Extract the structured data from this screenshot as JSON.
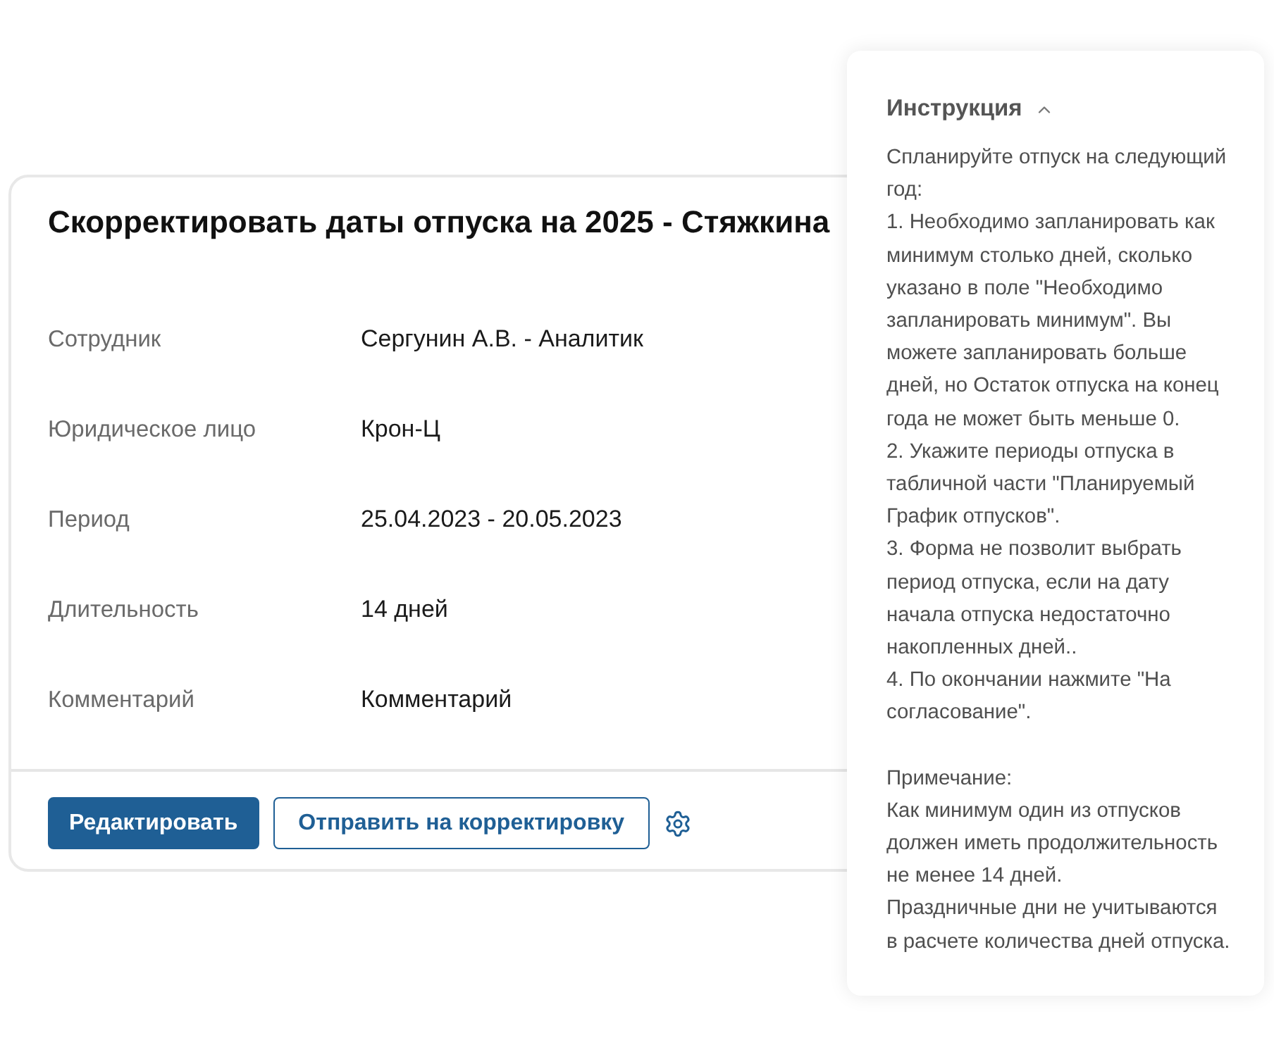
{
  "card": {
    "title": "Скорректировать даты отпуска на 2025 - Стяжкина",
    "fields": [
      {
        "label": "Сотрудник",
        "value": "Сергунин А.В. - Аналитик"
      },
      {
        "label": "Юридическое лицо",
        "value": "Крон-Ц"
      },
      {
        "label": "Период",
        "value": "25.04.2023 - 20.05.2023"
      },
      {
        "label": "Длительность",
        "value": "14 дней"
      },
      {
        "label": "Комментарий",
        "value": "Комментарий"
      }
    ],
    "buttons": [
      {
        "kind": "primary",
        "label": "Редактировать"
      },
      {
        "kind": "secondary",
        "label": "Отправить на корректировку"
      }
    ]
  },
  "instruction": {
    "title": "Инструкция",
    "expanded": true,
    "sections": [
      {
        "paragraphs": [
          "Спланируйте отпуск на следующий год:",
          "1. Необходимо запланировать как минимум столько дней, сколько указано в поле \"Необходимо запланировать минимум\". Вы можете запланировать больше дней, но Остаток отпуска на конец года не может быть меньше 0.",
          "2. Укажите периоды отпуска в табличной части \"Планируемый График отпусков\".",
          "3. Форма не позволит выбрать период отпуска, если на дату начала отпуска недостаточно накопленных дней..",
          "4. По окончании нажмите \"На согласование\"."
        ]
      },
      {
        "paragraphs": [
          "Примечание:",
          "Как минимум один из отпусков должен иметь продолжительность не менее 14 дней.",
          "Праздничные дни не учитываются в расчете количества дней отпуска."
        ]
      }
    ]
  }
}
